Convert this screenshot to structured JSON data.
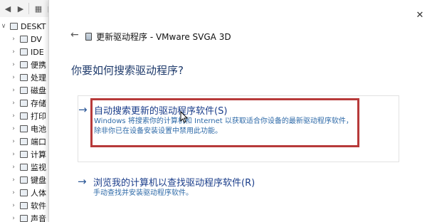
{
  "toolbar": {
    "buttons": [
      "back-icon",
      "forward-icon",
      "properties-icon",
      "update-driver-icon",
      "scan-icon",
      "disable-icon",
      "uninstall-icon",
      "download-icon"
    ],
    "uninstall_color": "#d12b2b"
  },
  "tree": {
    "root_label": "DESKT",
    "items": [
      {
        "label": "DV",
        "icon": "dvd-drive-icon"
      },
      {
        "label": "IDE",
        "icon": "ide-controller-icon"
      },
      {
        "label": "便携",
        "icon": "portable-device-icon"
      },
      {
        "label": "处理",
        "icon": "processor-icon"
      },
      {
        "label": "磁盘",
        "icon": "disk-drive-icon"
      },
      {
        "label": "存储",
        "icon": "storage-icon"
      },
      {
        "label": "打印",
        "icon": "printer-icon"
      },
      {
        "label": "电池",
        "icon": "battery-icon"
      },
      {
        "label": "端口",
        "icon": "port-icon"
      },
      {
        "label": "计算",
        "icon": "computer-icon"
      },
      {
        "label": "监视",
        "icon": "monitor-icon"
      },
      {
        "label": "键盘",
        "icon": "keyboard-icon"
      },
      {
        "label": "人体",
        "icon": "hid-icon"
      },
      {
        "label": "软件",
        "icon": "software-icon"
      },
      {
        "label": "声音",
        "icon": "sound-icon"
      }
    ]
  },
  "dialog": {
    "title": "更新驱动程序 - VMware SVGA 3D",
    "close_label": "✕",
    "back_label": "←",
    "heading": "你要如何搜索驱动程序?",
    "option1": {
      "arrow": "→",
      "title": "自动搜索更新的驱动程序软件(S)",
      "description": "Windows 将搜索你的计算机和 Internet 以获取适合你设备的最新驱动程序软件，除非你已在设备安装设置中禁用此功能。",
      "highlight_color": "#b73a3a"
    },
    "option2": {
      "arrow": "→",
      "title": "浏览我的计算机以查找驱动程序软件(R)",
      "description": "手动查找并安装驱动程序软件。"
    }
  }
}
